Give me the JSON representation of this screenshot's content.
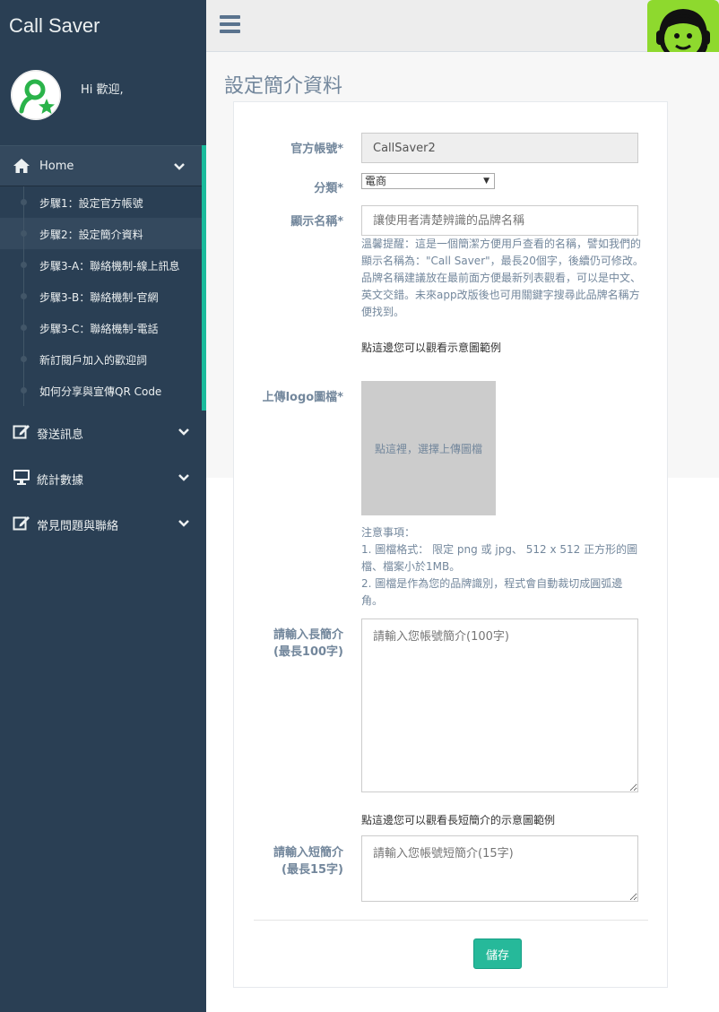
{
  "app": {
    "brand": "Call Saver",
    "welcome": "Hi 歡迎,"
  },
  "sidebar": {
    "home_label": "Home",
    "sub_items": [
      {
        "label": "步驟1：設定官方帳號",
        "active": false
      },
      {
        "label": "步驟2：設定簡介資料",
        "active": true
      },
      {
        "label": "步驟3-A：聯絡機制-線上訊息",
        "active": false
      },
      {
        "label": "步驟3-B：聯絡機制-官網",
        "active": false
      },
      {
        "label": "步驟3-C：聯絡機制-電話",
        "active": false
      },
      {
        "label": "新訂閱戶加入的歡迎詞",
        "active": false
      },
      {
        "label": "如何分享與宣傳QR Code",
        "active": false
      }
    ],
    "menus": [
      {
        "label": "發送訊息",
        "icon": "edit-icon"
      },
      {
        "label": "統計數據",
        "icon": "monitor-icon"
      },
      {
        "label": "常見問題與聯絡",
        "icon": "edit-icon"
      }
    ]
  },
  "page": {
    "title": "設定簡介資料"
  },
  "form": {
    "account_label": "官方帳號*",
    "account_value": "CallSaver2",
    "category_label": "分類*",
    "category_value": "電商",
    "display_name_label": "顯示名稱*",
    "display_name_placeholder": "讓使用者清楚辨識的品牌名稱",
    "display_name_help": "溫馨提醒：這是一個簡潔方便用戶查看的名稱，譬如我們的顯示名稱為：\"Call Saver\"，最長20個字，後續仍可修改。品牌名稱建議放在最前面方便最新列表觀看，可以是中文、英文交錯。未來app改版後也可用關鍵字搜尋此品牌名稱方便找到。",
    "display_name_example_link": "點這邊您可以觀看示意圖範例",
    "logo_label": "上傳logo圖檔*",
    "logo_upload_text": "點這裡，選擇上傳圖檔",
    "logo_notes": [
      "注意事項：",
      "1. 圖檔格式： 限定 png 或 jpg、 512 x 512 正方形的圖檔、檔案小於1MB。",
      "2. 圖檔是作為您的品牌識別，程式會自動裁切成圓弧邊角。"
    ],
    "long_intro_label_1": "請輸入長簡介",
    "long_intro_label_2": "(最長100字)",
    "long_intro_placeholder": "請輸入您帳號簡介(100字)",
    "long_intro_example_link": "點這邊您可以觀看長短簡介的示意圖範例",
    "short_intro_label_1": "請輸入短簡介",
    "short_intro_label_2": "(最長15字)",
    "short_intro_placeholder": "請輸入您帳號短簡介(15字)",
    "save_label": "儲存"
  },
  "colors": {
    "sidebar": "#2a3f54",
    "accent": "#1abb9c",
    "button": "#26b99a",
    "logo_bg": "#8ed92e"
  }
}
